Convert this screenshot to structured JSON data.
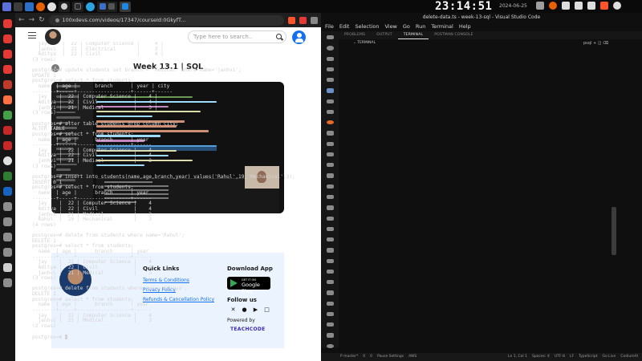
{
  "taskbar": {
    "windows": [
      {
        "icon": "firefox-icon",
        "label": ""
      },
      {
        "icon": "github-icon",
        "label": ""
      },
      {
        "icon": "terminal-icon",
        "label": ""
      },
      {
        "icon": "telegram-icon",
        "label": ""
      },
      {
        "icon": "window-icon",
        "label": ""
      },
      {
        "icon": "vscode-icon",
        "label": ""
      }
    ],
    "clock": "23:14:51",
    "date": "2024-06-25"
  },
  "browser": {
    "url": "100xdevs.com/videos/17347/courseId:0GkyfT...",
    "search_placeholder": "Type here to search..",
    "lesson_title": "Week 13.1 | SQL",
    "footer": {
      "quick_links_heading": "Quick Links",
      "links": [
        "Terms & Conditions",
        "Privacy Policy",
        "Refunds & Cancellation Policy"
      ],
      "download_heading": "Download App",
      "gplay_small": "GET IT ON",
      "gplay_big": "Google Play",
      "follow_heading": "Follow us",
      "powered_by": "Powered by",
      "brand": "TEACHCODE"
    }
  },
  "vscode": {
    "window_title": "delete-data.ts - week-13-sql - Visual Studio Code",
    "menu": [
      "File",
      "Edit",
      "Selection",
      "View",
      "Go",
      "Run",
      "Terminal",
      "Help"
    ],
    "panel_tabs": [
      "PROBLEMS",
      "OUTPUT",
      "TERMINAL",
      "POSTMAN CONSOLE"
    ],
    "active_tab": "TERMINAL",
    "terminal_label": "TERMINAL",
    "terminal_tools": "psql",
    "terminal_lines": [
      "  jay     |  22 | Computer Science |     4 |",
      "  janhvi  |  21 | Electrical       |     3 |",
      "  Aditya  |  22 | Civil            |     4 |",
      "(3 rows)",
      "",
      "postgres=# update students set branch = 'Medical' where name='janhvi';",
      "UPDATE 1",
      "postgres=# select * from students;",
      "  name  | age |      branch      | year | city",
      "--------+-----+------------------+------+------",
      "  jay    |  22 | Computer Science |    4 |",
      "  Aditya |  22 | Civil            |    4 |",
      "  janhvi |  21 | Medical          |    3 |",
      "(3 rows)",
      "",
      "postgres=# alter table students drop column city;",
      "ALTER TABLE",
      "postgres=# select * from students;",
      "  name  | age |      branch      | year",
      "--------+-----+------------------+------",
      "  jay    |  22 | Computer Science |    4",
      "  Aditya |  22 | Civil            |    4",
      "  janhvi |  21 | Medical          |    3",
      "(3 rows)",
      "",
      "postgres=# insert into students(name,age,branch,year) values('Rahul',19,'Mechanical',3);",
      "INSERT 0 1",
      "postgres=# select * from students;",
      "  name  | age |      branch      | year",
      "--------+-----+------------------+------",
      "  jay    |  22 | Computer Science |    4",
      "  Aditya |  22 | Civil            |    4",
      "  janhvi |  21 | Medical          |    3",
      "  Rahul  |  19 | Mechanical       |    3",
      "(4 rows)",
      "",
      "postgres=# delete from students where name='Rahul';",
      "DELETE 1",
      "postgres=# select * from students;",
      "  name  | age |      branch      | year",
      "--------+-----+------------------+------",
      "  jay    |  22 | Computer Science |    4",
      "  Aditya |  22 | Civil            |    4",
      "  janhvi |  21 | Medical          |    3",
      "(3 rows)",
      "",
      "postgres=# delete from students where name='Aditya';",
      "DELETE 1",
      "postgres=# select * from students;",
      "  name  | age |      branch      | year",
      "--------+-----+------------------+------",
      "  jay    |  22 | Computer Science |    4",
      "  janhvi |  21 | Medical          |    3",
      "(2 rows)",
      "",
      "postgres=# "
    ],
    "status_left": [
      "P master*",
      "0",
      "0",
      "Pause Settings",
      "AWS"
    ],
    "status_right": [
      "Ln 1, Col 1",
      "Spaces: 4",
      "UTF-8",
      "LF",
      "TypeScript",
      "Go Live",
      "CodiumAI"
    ]
  }
}
